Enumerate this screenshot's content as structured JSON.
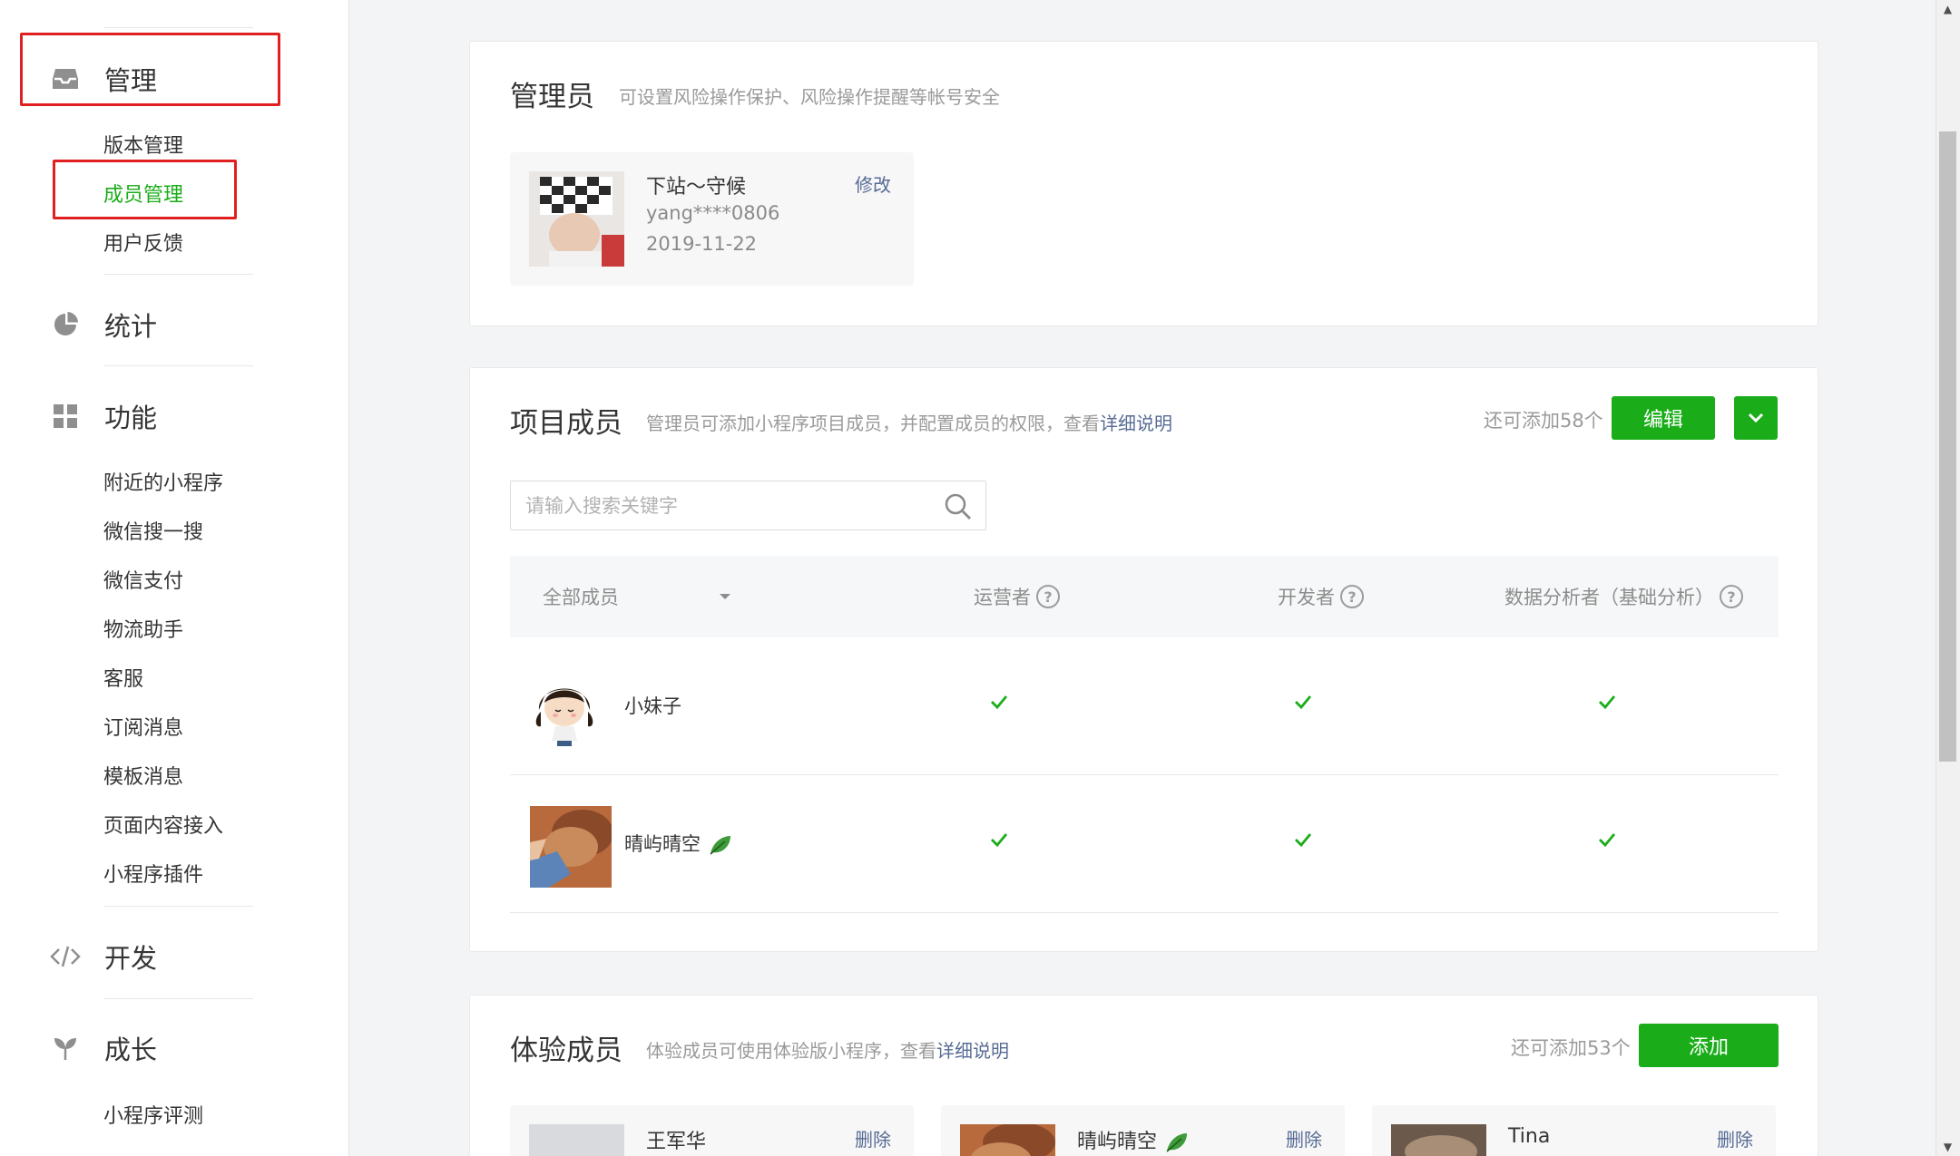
{
  "sidebar": {
    "groups": {
      "manage": {
        "label": "管理",
        "icon": "inbox-icon"
      },
      "stats": {
        "label": "统计",
        "icon": "pie-chart-icon"
      },
      "features": {
        "label": "功能",
        "icon": "grid-icon"
      },
      "develop": {
        "label": "开发",
        "icon": "code-icon"
      },
      "growth": {
        "label": "成长",
        "icon": "sprout-icon"
      }
    },
    "manage_items": [
      "版本管理",
      "成员管理",
      "用户反馈"
    ],
    "feature_items": [
      "附近的小程序",
      "微信搜一搜",
      "微信支付",
      "物流助手",
      "客服",
      "订阅消息",
      "模板消息",
      "页面内容接入",
      "小程序插件"
    ],
    "growth_items": [
      "小程序评测"
    ],
    "active_item": "成员管理"
  },
  "admin": {
    "title": "管理员",
    "desc": "可设置风险操作保护、风险操作提醒等帐号安全",
    "name": "下站～守候",
    "account": "yang****0806",
    "date": "2019-11-22",
    "action": "修改"
  },
  "project_members": {
    "title": "项目成员",
    "desc_prefix": "管理员可添加小程序项目成员，并配置成员的权限，查看",
    "desc_link": "详细说明",
    "quota": "还可添加58个",
    "edit_button": "编辑",
    "search_placeholder": "请输入搜索关键字",
    "filter_label": "全部成员",
    "columns": [
      "运营者",
      "开发者",
      "数据分析者（基础分析）"
    ],
    "rows": [
      {
        "name": "小妹子",
        "operator": true,
        "developer": true,
        "analyst": true
      },
      {
        "name": "晴屿晴空",
        "operator": true,
        "developer": true,
        "analyst": true
      }
    ]
  },
  "trial_members": {
    "title": "体验成员",
    "desc_prefix": "体验成员可使用体验版小程序，查看",
    "desc_link": "详细说明",
    "quota": "还可添加53个",
    "add_button": "添加",
    "members": [
      {
        "name": "王军华",
        "action": "删除"
      },
      {
        "name": "晴屿晴空",
        "action": "删除"
      },
      {
        "name": "Tina",
        "action": "删除"
      }
    ]
  },
  "colors": {
    "accent_green": "#1aad19",
    "link_blue": "#576b95",
    "highlight_red": "#e02020"
  }
}
